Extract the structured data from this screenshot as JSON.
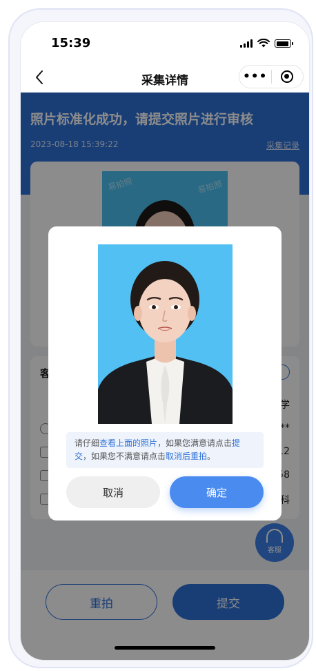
{
  "status_bar": {
    "time": "15:39"
  },
  "nav": {
    "title": "采集详情",
    "more_label": "•••"
  },
  "banner": {
    "title": "照片标准化成功，请提交照片进行审核",
    "timestamp": "2023-08-18 15:39:22",
    "records_link": "采集记录"
  },
  "photo_watermark": [
    "易拍照",
    "易拍照"
  ],
  "info_card": {
    "title": "客",
    "rows": [
      {
        "value": "学"
      },
      {
        "value": "**"
      },
      {
        "value": "12"
      },
      {
        "value": "58"
      },
      {
        "value": "科"
      }
    ]
  },
  "service_button": {
    "label": "客服"
  },
  "bottom": {
    "retake_label": "重拍",
    "submit_label": "提交"
  },
  "modal": {
    "tip_parts": [
      "请仔细",
      "查看上面的照片",
      "，如果您满意请点击",
      "提交",
      "，如果您不满意请点击",
      "取消后重拍",
      "。"
    ],
    "cancel_label": "取消",
    "confirm_label": "确定"
  },
  "colors": {
    "brand_blue": "#2f72d8",
    "photo_bg": "#52c0f2"
  }
}
